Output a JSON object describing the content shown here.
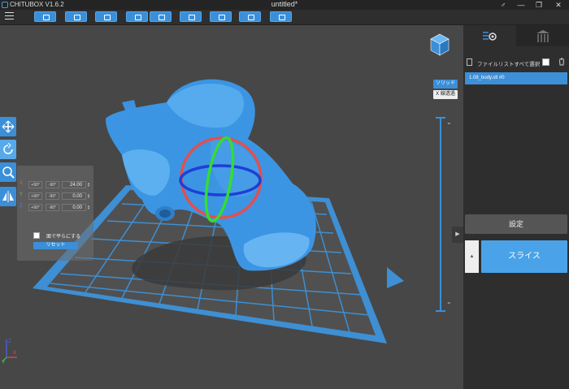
{
  "window": {
    "app_title": "CHITUBOX V1.6.2",
    "doc_title": "untitled*",
    "controls": {
      "account": "♂",
      "minimize": "—",
      "restore": "❐",
      "close": "✕"
    }
  },
  "toolbar": {
    "buttons": [
      "open-icon",
      "save-icon",
      "cut-icon",
      "undo-icon",
      "redo-icon",
      "copy-icon",
      "arrange-icon",
      "hollow-icon",
      "slice-preview-icon"
    ]
  },
  "rotate_panel": {
    "rows": [
      {
        "axis": "X",
        "minus": "+90°",
        "plus": "-90°",
        "value": "24.00",
        "color": "#e05555"
      },
      {
        "axis": "Y",
        "minus": "+90°",
        "plus": "-90°",
        "value": "0.00",
        "color": "#56c856"
      },
      {
        "axis": "Z",
        "minus": "+90°",
        "plus": "-90°",
        "value": "0.00",
        "color": "#5577ee"
      }
    ],
    "flatten_label": "面で平らにする",
    "reset_label": "リセット"
  },
  "view_mode": {
    "solid": "ソリッド",
    "xray": "X 線透過"
  },
  "axes": {
    "x": "X",
    "y": "Y",
    "z": "Z"
  },
  "right_panel": {
    "file_list_label": "ファイルリストすべて選択",
    "file_item": "1.08_body.stl #0",
    "settings_label": "設定",
    "slice_label": "スライス"
  },
  "colors": {
    "accent": "#3a8fd8",
    "model": "#4aa3ee",
    "ring_x": "#e05050",
    "ring_y": "#33dd33",
    "ring_z": "#1f3fd8"
  }
}
